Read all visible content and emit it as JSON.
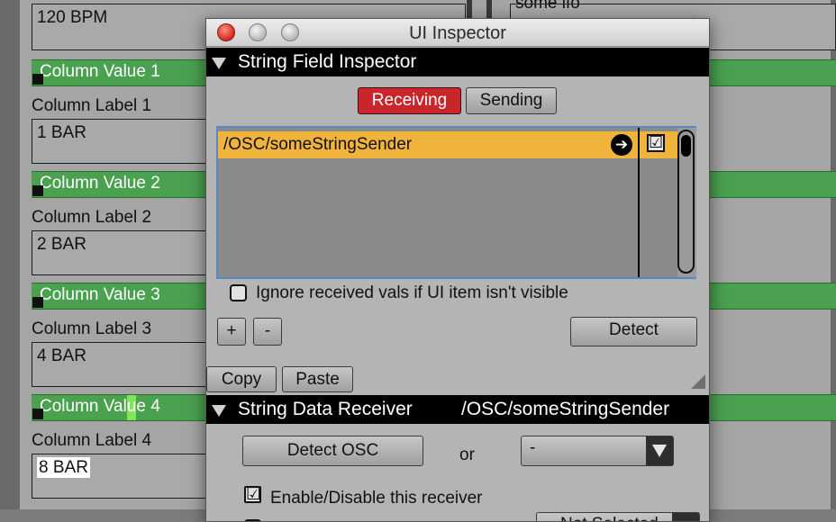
{
  "background": {
    "top_left_value": "120 BPM",
    "top_right_value": "some lfo",
    "columns": [
      {
        "value_label": "Column Value 1",
        "label_caption": "Column Label 1",
        "label_value": "1 BAR"
      },
      {
        "value_label": "Column Value 2",
        "label_caption": "Column Label 2",
        "label_value": "2 BAR"
      },
      {
        "value_label": "Column Value 3",
        "label_caption": "Column Label 3",
        "label_value": "4 BAR"
      },
      {
        "value_label": "Column Value 4",
        "label_caption": "Column Label 4",
        "label_value": "8 BAR"
      }
    ]
  },
  "inspector": {
    "window_title": "UI Inspector",
    "section1": {
      "title": "String Field Inspector",
      "tabs": {
        "receiving": "Receiving",
        "sending": "Sending"
      },
      "active_tab": "receiving",
      "list_rows": [
        {
          "address": "/OSC/someStringSender",
          "enabled": "☑",
          "arrow": "➔"
        }
      ],
      "ignore_label": "Ignore received vals if UI item isn't visible",
      "add_label": "+",
      "remove_label": "-",
      "detect_label": "Detect",
      "copy_label": "Copy",
      "paste_label": "Paste"
    },
    "section2": {
      "title": "String Data Receiver",
      "address": "/OSC/someStringSender",
      "detect_osc_label": "Detect OSC",
      "or_label": "or",
      "source_value": "-",
      "enable_label": "Enable/Disable this receiver",
      "enable_check": "☑",
      "dropdown2_value": "Not Selected"
    }
  },
  "colors": {
    "slider_green": "#4aa150",
    "active_tab_red": "#c9262c",
    "selected_row": "#f0b33b",
    "list_border_blue": "#5b87c6"
  }
}
